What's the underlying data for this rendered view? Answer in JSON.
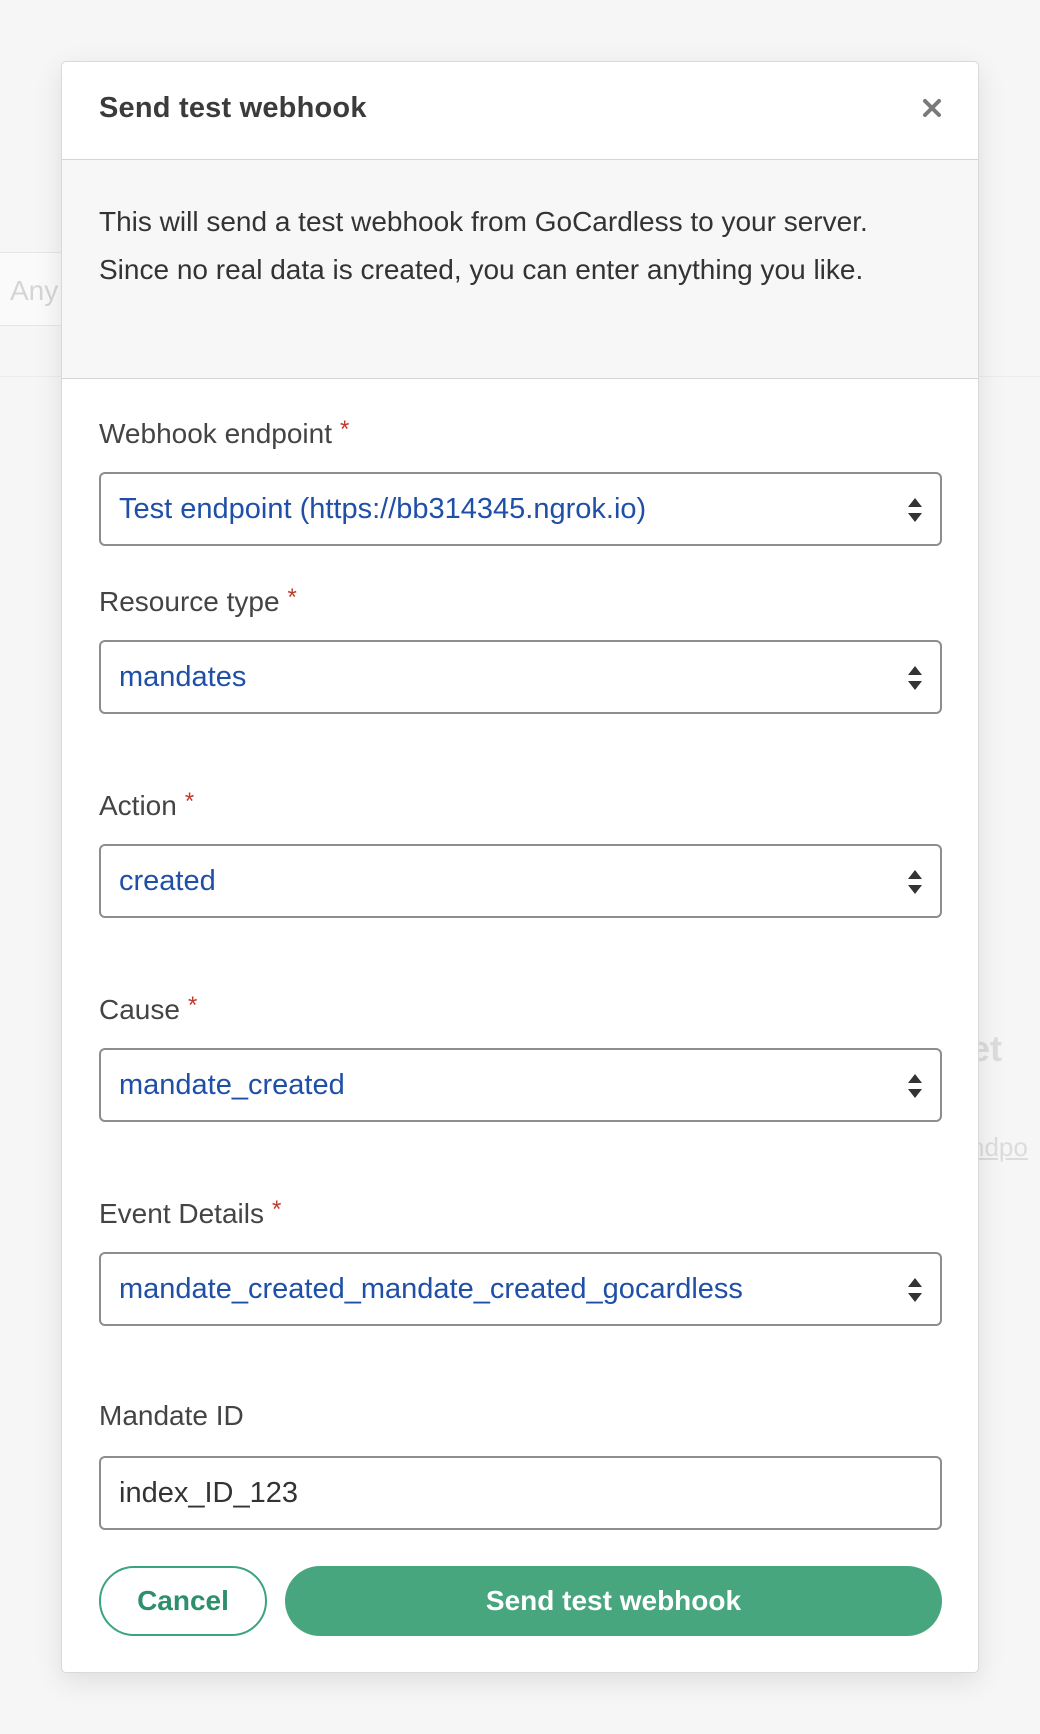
{
  "background": {
    "input_hint": "Any"
  },
  "modal": {
    "title": "Send test webhook",
    "intro": "This will send a test webhook from GoCardless to your server. Since no real data is created, you can enter anything you like.",
    "required_marker": "*",
    "fields": {
      "endpoint": {
        "label": "Webhook endpoint",
        "value": "Test endpoint (https://bb314345.ngrok.io)"
      },
      "resource_type": {
        "label": "Resource type",
        "value": "mandates"
      },
      "action": {
        "label": "Action",
        "value": "created"
      },
      "cause": {
        "label": "Cause",
        "value": "mandate_created"
      },
      "event_details": {
        "label": "Event Details",
        "value": "mandate_created_mandate_created_gocardless"
      },
      "mandate_id": {
        "label": "Mandate ID",
        "value": "index_ID_123"
      }
    },
    "buttons": {
      "cancel": "Cancel",
      "send": "Send test webhook"
    }
  },
  "colors": {
    "accent": "#48a67f",
    "link_value": "#1f4fa6",
    "required": "#c0392b"
  },
  "icons": {
    "close": "close-icon",
    "select_arrows": "sort-arrows-icon"
  }
}
